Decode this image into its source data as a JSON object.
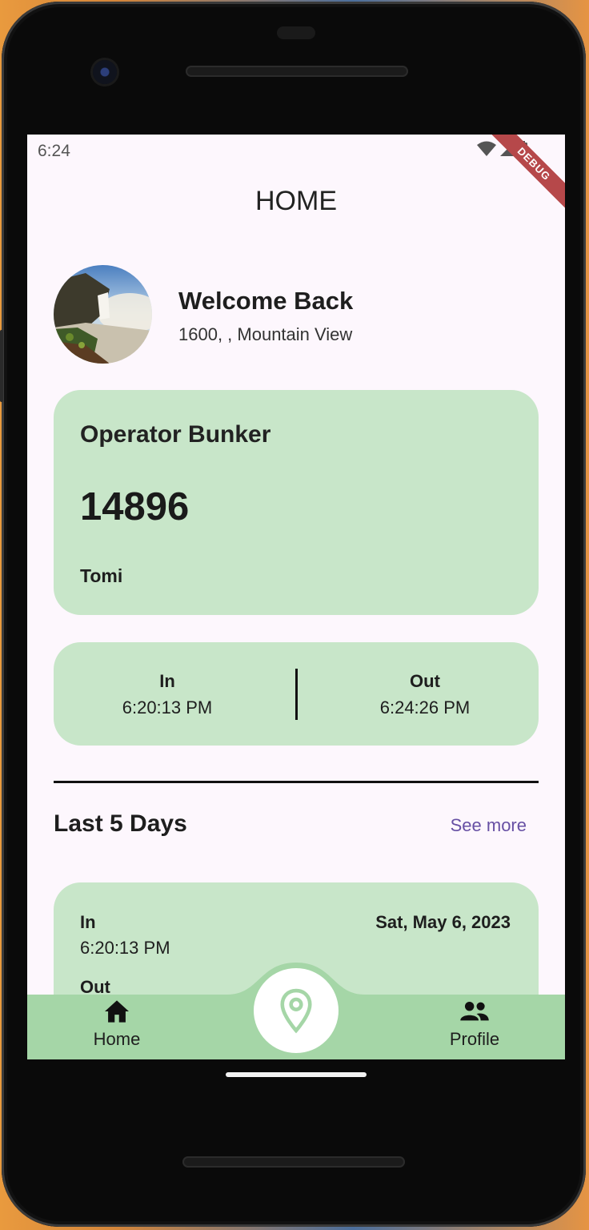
{
  "status_bar": {
    "time": "6:24",
    "debug_label": "DEBUG"
  },
  "app_bar": {
    "title": "HOME"
  },
  "profile": {
    "greeting": "Welcome Back",
    "address": "1600, , Mountain View"
  },
  "operator_card": {
    "title": "Operator Bunker",
    "number": "14896",
    "name": "Tomi"
  },
  "today": {
    "in_label": "In",
    "in_time": "6:20:13 PM",
    "out_label": "Out",
    "out_time": "6:24:26 PM"
  },
  "history_section": {
    "title": "Last 5 Days",
    "see_more_label": "See more",
    "entries": [
      {
        "in_label": "In",
        "in_time": "6:20:13 PM",
        "date": "Sat, May 6, 2023",
        "out_label": "Out"
      }
    ]
  },
  "bottom_nav": {
    "home_label": "Home",
    "profile_label": "Profile"
  },
  "colors": {
    "card_bg": "#c8e6c9",
    "nav_bg": "#a5d6a7",
    "accent_link": "#6750a4",
    "screen_bg": "#fdf7fd"
  }
}
